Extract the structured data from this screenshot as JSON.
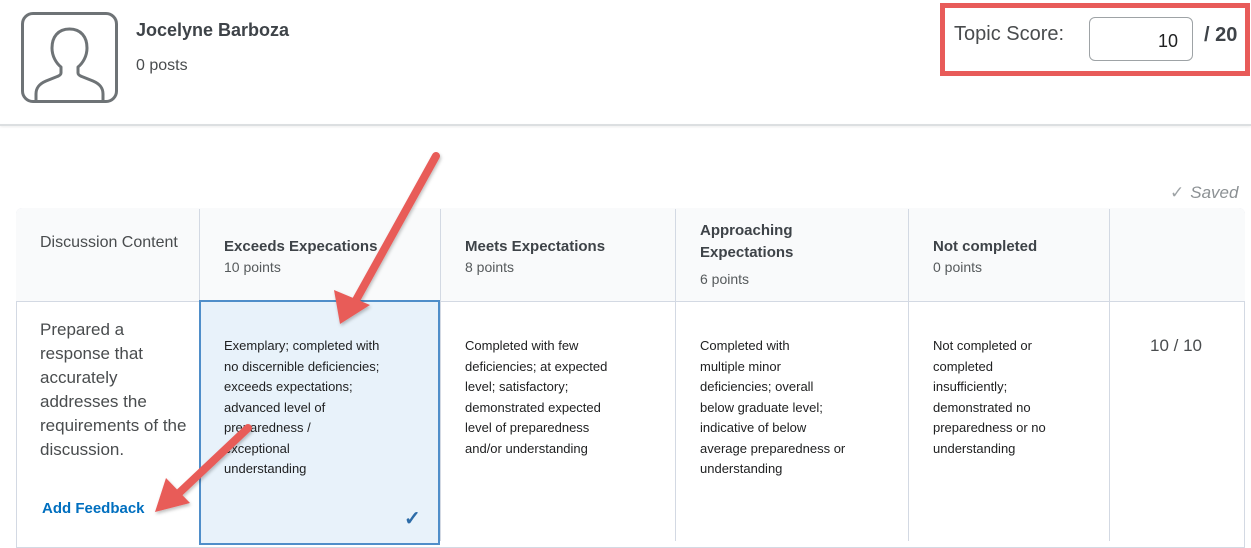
{
  "user": {
    "name": "Jocelyne Barboza",
    "posts": "0 posts"
  },
  "score": {
    "label": "Topic Score:",
    "value": "10",
    "total": "/ 20"
  },
  "status": {
    "saved": "Saved"
  },
  "rubric": {
    "criterion_name": "Discussion Content",
    "criterion_description": "Prepared a response that accurately addresses the requirements of the discussion.",
    "add_feedback": "Add Feedback",
    "criterion_score": "10 / 10",
    "levels": [
      {
        "name": "Exceeds Expecations",
        "points": "10 points",
        "description": [
          "Exemplary; completed with",
          "no discernible deficiencies;",
          "exceeds expectations;",
          "advanced level of",
          "preparedness /",
          "exceptional",
          "understanding"
        ]
      },
      {
        "name": "Meets Expectations",
        "points": "8 points",
        "description": [
          "Completed with few",
          "deficiencies; at expected",
          "level; satisfactory;",
          "demonstrated expected",
          "level of preparedness",
          "and/or understanding"
        ]
      },
      {
        "name": "Approaching Expectations",
        "points": "6 points",
        "description": [
          "Completed with",
          "multiple minor",
          "deficiencies; overall",
          "below graduate level;",
          "indicative of below",
          "average preparedness or",
          "understanding"
        ]
      },
      {
        "name": "Not completed",
        "points": "0 points",
        "description": [
          "Not completed or",
          "completed",
          "insufficiently;",
          "demonstrated no",
          "preparedness or no",
          "understanding"
        ]
      }
    ]
  },
  "colors": {
    "highlight_box": "#e85b59",
    "selected_border": "#4f8ec9",
    "selected_fill": "#e8f2fa",
    "link": "#006fbf"
  },
  "icons": {
    "avatar": "user-avatar-icon",
    "saved": "checkmark-icon",
    "selected": "checkmark-icon"
  }
}
